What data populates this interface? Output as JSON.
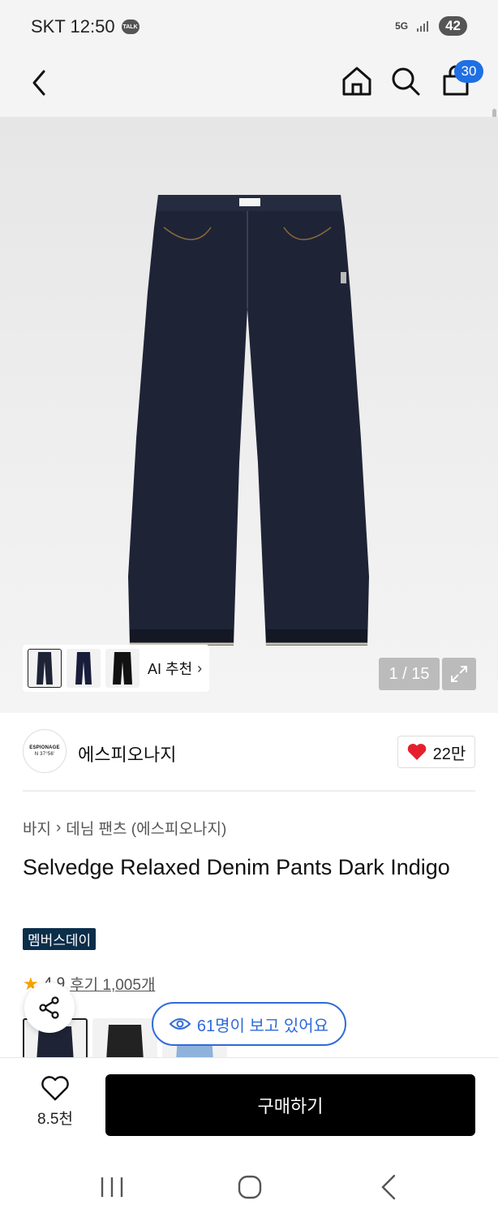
{
  "status_bar": {
    "carrier_time": "SKT 12:50",
    "talk_badge": "TALK",
    "network": "5G",
    "battery": "42"
  },
  "header": {
    "cart_count": "30",
    "icons": [
      "back-icon",
      "home-icon",
      "search-icon",
      "cart-icon"
    ]
  },
  "gallery": {
    "ai_label": "AI 추천",
    "page_indicator": "1 / 15"
  },
  "brand": {
    "logo_text": "ESPIONAGE",
    "logo_sub": "N 37°56'",
    "name": "에스피오나지",
    "likes": "22만"
  },
  "product": {
    "breadcrumb": [
      "바지",
      "데님 팬츠 (에스피오나지)"
    ],
    "title": "Selvedge Relaxed Denim Pants Dark Indigo",
    "badge": "멤버스데이",
    "rating": "4.9",
    "reviews": "후기 1,005개"
  },
  "viewers": {
    "text": "61명이 보고 있어요"
  },
  "bottom": {
    "wish_count": "8.5천",
    "buy_label": "구매하기"
  },
  "colors": {
    "accent_blue": "#1f6fe5",
    "member_badge": "#0b2e4a",
    "heart_red": "#e5202e",
    "denim": "#1e2436"
  }
}
